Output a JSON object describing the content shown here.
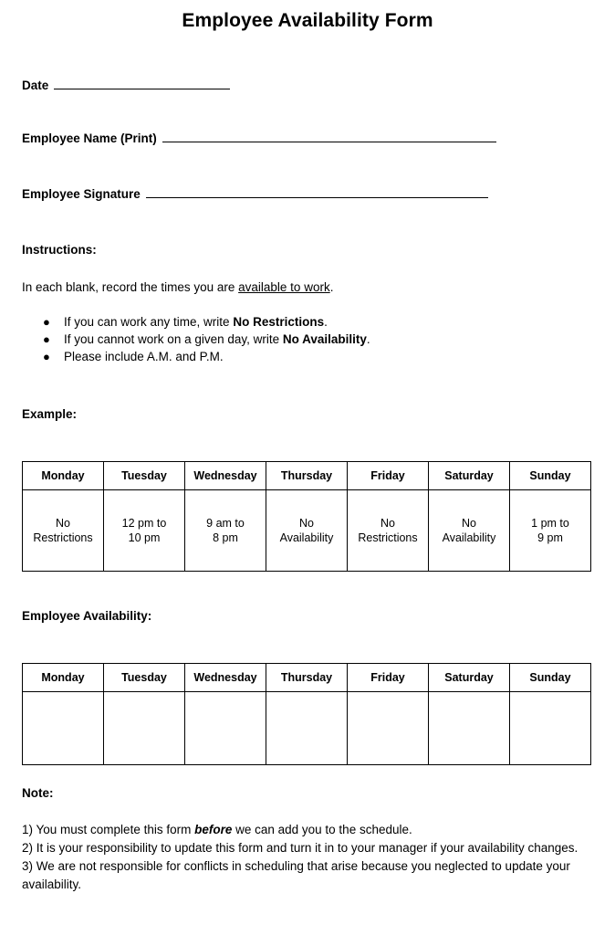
{
  "document": {
    "title": "Employee Availability Form"
  },
  "fields": [
    {
      "label": "Date"
    },
    {
      "label": "Employee Name (Print)"
    },
    {
      "label": "Employee Signature"
    }
  ],
  "instructions": {
    "heading": "Instructions:",
    "intro_before": "In each blank, record the times you are ",
    "intro_underlined": "available to work",
    "intro_after": ".",
    "bullet_glyph": "●",
    "bullets": [
      {
        "before": "If you can work any time, write ",
        "bold": "No Restrictions",
        "after": "."
      },
      {
        "before": "If you cannot work on a given day, write ",
        "bold": "No Availability",
        "after": "."
      },
      {
        "before": "Please include A.M. and P.M.",
        "bold": "",
        "after": ""
      }
    ]
  },
  "example": {
    "heading": "Example:",
    "columns": [
      "Monday",
      "Tuesday",
      "Wednesday",
      "Thursday",
      "Friday",
      "Saturday",
      "Sunday"
    ],
    "values": [
      {
        "line1": "No",
        "line2": "Restrictions"
      },
      {
        "line1": "12 pm to",
        "line2": "10 pm"
      },
      {
        "line1": "9 am to",
        "line2": "8 pm"
      },
      {
        "line1": "No",
        "line2": "Availability"
      },
      {
        "line1": "No",
        "line2": "Restrictions"
      },
      {
        "line1": "No",
        "line2": "Availability"
      },
      {
        "line1": "1 pm to",
        "line2": "9 pm"
      }
    ]
  },
  "availability": {
    "heading": "Employee Availability:",
    "columns": [
      "Monday",
      "Tuesday",
      "Wednesday",
      "Thursday",
      "Friday",
      "Saturday",
      "Sunday"
    ],
    "values": [
      {
        "line1": "",
        "line2": ""
      },
      {
        "line1": "",
        "line2": ""
      },
      {
        "line1": "",
        "line2": ""
      },
      {
        "line1": "",
        "line2": ""
      },
      {
        "line1": "",
        "line2": ""
      },
      {
        "line1": "",
        "line2": ""
      },
      {
        "line1": "",
        "line2": ""
      }
    ]
  },
  "note": {
    "heading": "Note:",
    "items": [
      {
        "before": "1) You must complete this form ",
        "emphasis": "before",
        "after": " we can add you to the schedule."
      },
      {
        "before": "2) It is your responsibility to update this form and turn it in to your manager if your availability changes.",
        "emphasis": "",
        "after": ""
      },
      {
        "before": "3) We are not responsible for conflicts in scheduling that arise because you neglected to update your availability.",
        "emphasis": "",
        "after": ""
      }
    ]
  },
  "colors": {
    "page_background": "#ffffff",
    "text": "#000000",
    "rule": "#000000"
  }
}
